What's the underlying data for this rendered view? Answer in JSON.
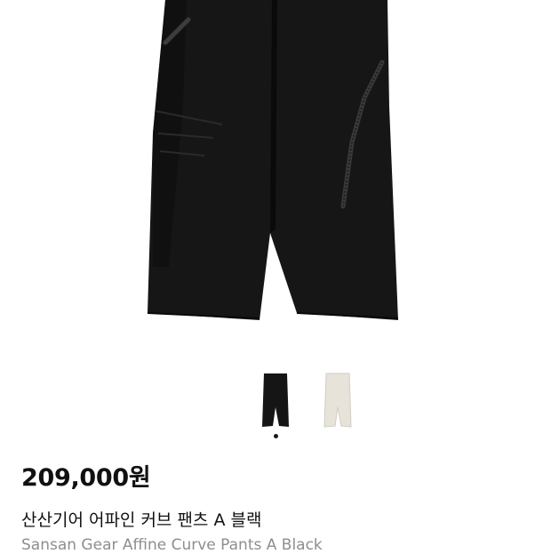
{
  "product": {
    "price": "209,000원",
    "name_ko": "산산기어 어파인 커브 팬츠 A 블랙",
    "name_en": "Sansan Gear Affine Curve Pants  A Black",
    "gallery_current_index": 0,
    "colors": {
      "black": "#151515",
      "ivory": "#e7e3da"
    }
  }
}
